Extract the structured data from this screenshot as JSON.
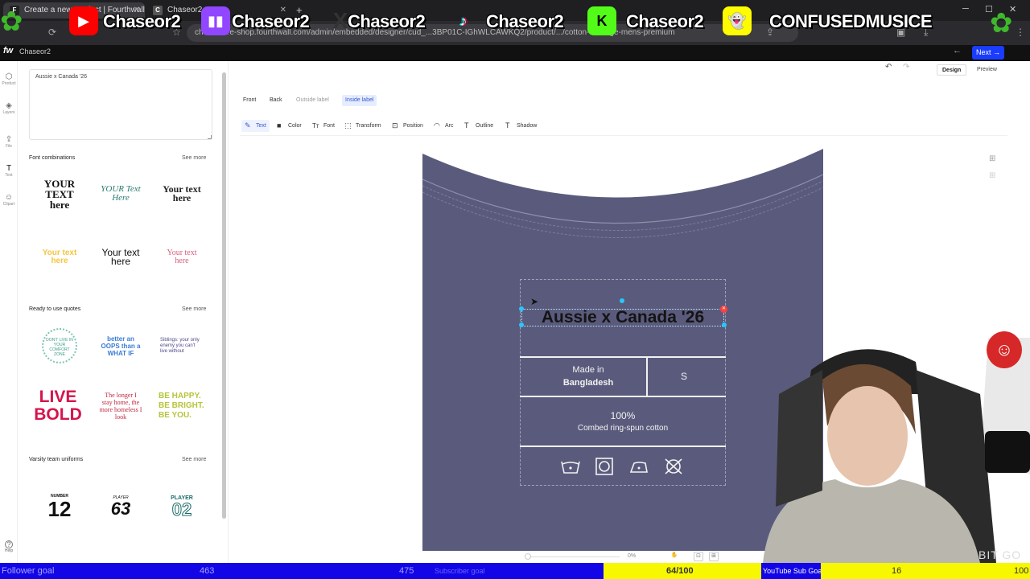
{
  "browser": {
    "tabs": [
      {
        "label": "Create a new product | Fourthwall",
        "active": true
      },
      {
        "label": "Chaseor2",
        "active": false
      }
    ],
    "url": "chasestore-shop.fourthwall.com/admin/embedded/designer/cud_...3BP01C-IGhWLCAWKQ2/product/.../cotton-heritage-mens-premium",
    "new_tab": "+"
  },
  "stream_overlay": {
    "handles": [
      "Chaseor2",
      "Chaseor2",
      "Chaseor2",
      "Chaseor2",
      "Chaseor2",
      "CONFUSEDMUSICE"
    ],
    "icons": [
      "youtube-icon",
      "twitch-icon",
      "x-icon",
      "tiktok-icon",
      "kick-icon",
      "snapchat-icon"
    ]
  },
  "app_header": {
    "logo": "fw",
    "shop_name": "Chaseor2",
    "next_label": "Next →",
    "back_icon": "←"
  },
  "rail": {
    "items": [
      {
        "glyph": "⬡",
        "label": "Product",
        "icon": "product-icon"
      },
      {
        "glyph": "◈",
        "label": "Layers",
        "icon": "layers-icon"
      },
      {
        "glyph": "⇪",
        "label": "File",
        "icon": "upload-icon"
      },
      {
        "glyph": "T",
        "label": "Text",
        "icon": "text-icon"
      },
      {
        "glyph": "☺",
        "label": "Clipart",
        "icon": "clipart-icon"
      }
    ],
    "help_glyph": "?",
    "help_label": "Help"
  },
  "text_panel": {
    "text_value": "Aussie x Canada '26",
    "font_combinations": {
      "title": "Font combinations",
      "see_more": "See more",
      "items": [
        "YOUR TEXT here",
        "YOUR Text Here",
        "Your text here",
        "Your text here",
        "Your text here",
        "Your text here"
      ]
    },
    "quotes": {
      "title": "Ready to use quotes",
      "see_more": "See more",
      "items": [
        "DON'T LIVE IN YOUR COMFORT ZONE",
        "better an OOPS than a WHAT IF",
        "Siblings: your only enemy you can't live without",
        "LIVE BOLD",
        "The longer I stay home, the more homeless I look",
        "BE HAPPY. BE BRIGHT. BE YOU."
      ]
    },
    "varsity": {
      "title": "Varsity team uniforms",
      "see_more": "See more",
      "items": [
        {
          "top": "NUMBER",
          "num": "12"
        },
        {
          "top": "PLAYER",
          "num": "63"
        },
        {
          "top": "PLAYER",
          "num": "02"
        }
      ]
    }
  },
  "editor": {
    "view_tabs": [
      "Design",
      "Preview"
    ],
    "active_view": "Design",
    "side_tabs": [
      "Front",
      "Back",
      "Outside label",
      "Inside label"
    ],
    "active_side": "Inside label",
    "tools": [
      {
        "label": "Text",
        "glyph": "✎"
      },
      {
        "label": "Color",
        "glyph": "■"
      },
      {
        "label": "Font",
        "glyph": "Tт"
      },
      {
        "label": "Transform",
        "glyph": "⬚"
      },
      {
        "label": "Position",
        "glyph": "⊡"
      },
      {
        "label": "Arc",
        "glyph": "◠"
      },
      {
        "label": "Outline",
        "glyph": "T"
      },
      {
        "label": "Shadow",
        "glyph": "T"
      }
    ],
    "active_tool": "Text",
    "undo": "↶",
    "redo": "↷",
    "zoom": "0%",
    "shirt_color": "#5a5b7c"
  },
  "inside_label": {
    "title": "Aussie x Canada '26",
    "made_in": "Made in",
    "country": "Bangladesh",
    "size": "S",
    "percent": "100%",
    "material": "Combed ring-spun cotton",
    "care_icons": [
      "wash-icon",
      "dry-icon",
      "iron-icon",
      "no-dryclean-icon"
    ]
  },
  "goals": {
    "follower_label": "Follower goal",
    "follower_current": "463",
    "follower_target": "475",
    "sub_label": "Subscriber goal",
    "sub_value": "64/100",
    "youtube_label": "YouTube Sub Goal",
    "youtube_current": "16",
    "youtube_target": "100",
    "webcam_text": "BIT GO"
  }
}
